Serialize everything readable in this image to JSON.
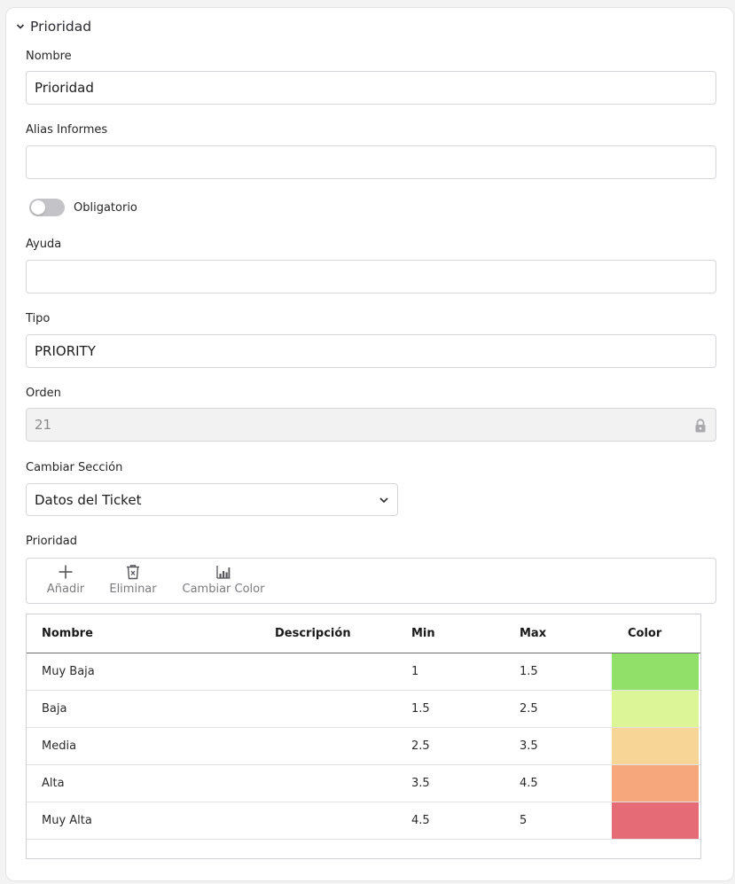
{
  "section": {
    "title": "Prioridad"
  },
  "fields": {
    "nombre": {
      "label": "Nombre",
      "value": "Prioridad"
    },
    "alias": {
      "label": "Alias Informes",
      "value": ""
    },
    "obligatorio": {
      "label": "Obligatorio",
      "checked": false
    },
    "ayuda": {
      "label": "Ayuda",
      "value": ""
    },
    "tipo": {
      "label": "Tipo",
      "value": "PRIORITY"
    },
    "orden": {
      "label": "Orden",
      "value": "21"
    },
    "seccion": {
      "label": "Cambiar Sección",
      "value": "Datos del Ticket"
    }
  },
  "priority_list": {
    "label": "Prioridad",
    "toolbar": {
      "add": "Añadir",
      "delete": "Eliminar",
      "color": "Cambiar Color"
    },
    "columns": [
      "Nombre",
      "Descripción",
      "Min",
      "Max",
      "Color"
    ],
    "rows": [
      {
        "nombre": "Muy Baja",
        "descripcion": "",
        "min": "1",
        "max": "1.5",
        "color": "#90e06a"
      },
      {
        "nombre": "Baja",
        "descripcion": "",
        "min": "1.5",
        "max": "2.5",
        "color": "#dcf596"
      },
      {
        "nombre": "Media",
        "descripcion": "",
        "min": "2.5",
        "max": "3.5",
        "color": "#f7d596"
      },
      {
        "nombre": "Alta",
        "descripcion": "",
        "min": "3.5",
        "max": "4.5",
        "color": "#f7a77c"
      },
      {
        "nombre": "Muy Alta",
        "descripcion": "",
        "min": "4.5",
        "max": "5",
        "color": "#e56c76"
      }
    ]
  }
}
